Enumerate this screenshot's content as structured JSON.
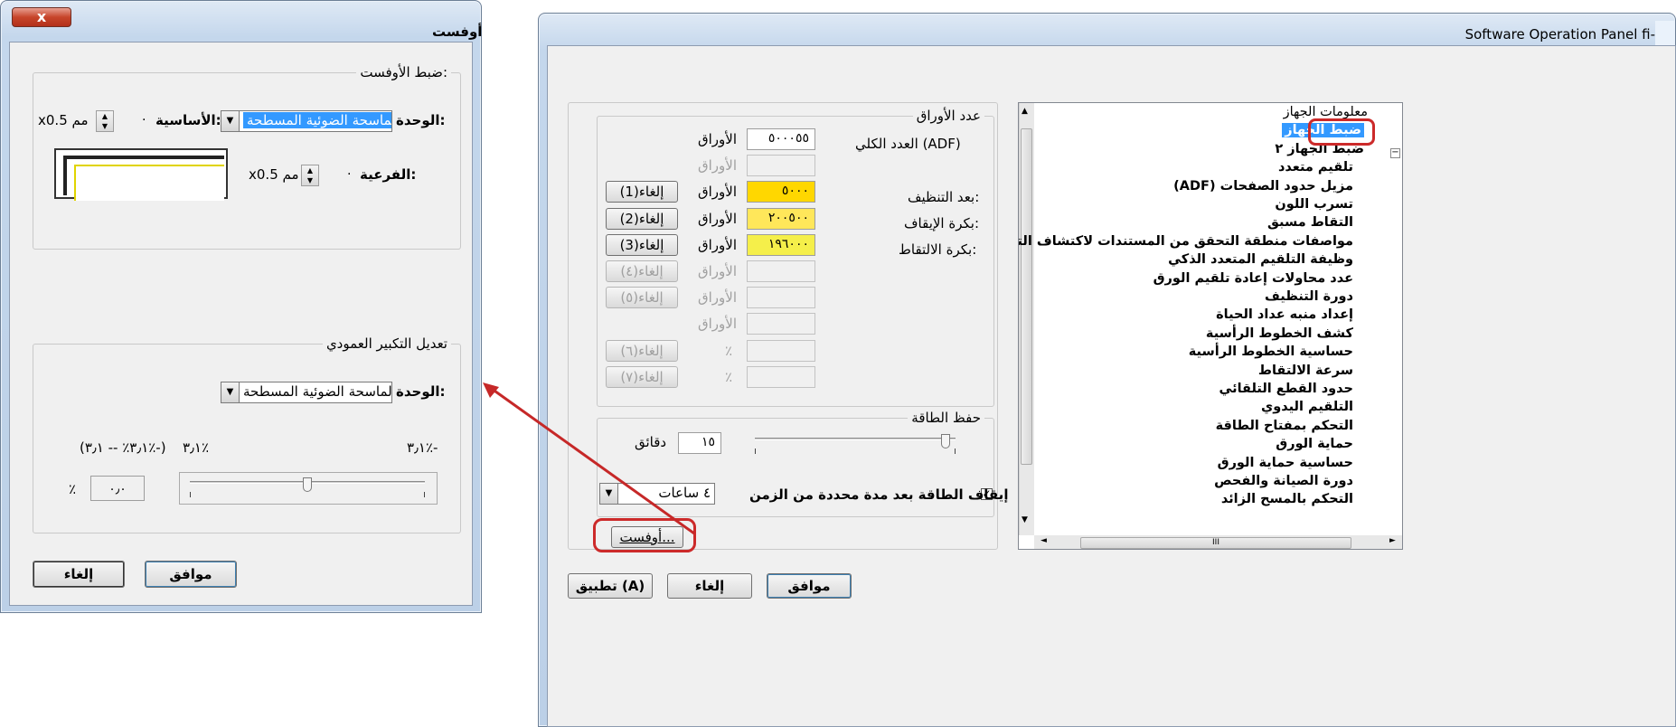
{
  "right_window": {
    "title": "Software Operation Panel fi-",
    "tree": {
      "items": [
        "معلومات الجهاز",
        "ضبط الجهاز",
        "ضبط الجهاز ٢",
        "تلقيم متعدد",
        "مزيل حدود الصفحات (ADF)",
        "تسرب اللون",
        "التقاط مسبق",
        "مواصفات منطقة التحقق من المستندات لاكتشاف التلقيم المتعدد",
        "وظيفة التلقيم المتعدد الذكي",
        "عدد محاولات إعادة تلقيم الورق",
        "دورة التنظيف",
        "إعداد منبه عداد الحياة",
        "كشف الخطوط الرأسية",
        "حساسية الخطوط الرأسية",
        "سرعة الالتقاط",
        "حدود القطع التلقائي",
        "التلقيم اليدوي",
        "التحكم بمفتاح الطاقة",
        "حماية الورق",
        "حساسية حماية الورق",
        "دورة الصيانة والفحص",
        "التحكم بالمسح الزائد"
      ],
      "scroll_marker": "III"
    },
    "sheets_group": {
      "legend": "عدد الأوراق",
      "total_label": "العدد الكلي (ADF)",
      "after_clean_label": "بعد التنظيف:",
      "brake_roller_label": "بكرة الإيقاف:",
      "pick_roller_label": "بكرة الالتقاط:",
      "unit": "الأوراق",
      "percent": "٪",
      "rows": [
        {
          "value": "٥٠٠٠٥٥",
          "button": ""
        },
        {
          "value": "",
          "button": ""
        },
        {
          "value": "٥٠٠٠",
          "button": "إلغاء(1)"
        },
        {
          "value": "٢٠٠٥٠٠",
          "button": "إلغاء(2)"
        },
        {
          "value": "١٩٦٠٠٠",
          "button": "إلغاء(3)"
        },
        {
          "value": "",
          "button": "إلغاء(٤)"
        },
        {
          "value": "",
          "button": "إلغاء(٥)"
        },
        {
          "value": "",
          "button": ""
        },
        {
          "value": "",
          "button": "إلغاء(٦)"
        },
        {
          "value": "",
          "button": "إلغاء(٧)"
        }
      ]
    },
    "power_group": {
      "legend": "حفظ الطاقة",
      "minutes_value": "١٥",
      "minutes_unit": "دقائق",
      "slider_level": 0.95,
      "auto_off_label": "إيقاف الطاقة بعد مدة محددة من الزمن",
      "auto_off_checked": true,
      "hours_value": "٤ ساعات"
    },
    "offset_button": "أوفست...",
    "buttons": {
      "ok": "موافق",
      "cancel": "إلغاء",
      "apply": "تطبيق (A)"
    }
  },
  "left_window": {
    "title": "أوفست",
    "close": "x",
    "offset_group": {
      "legend": "ضبط الأوفست:",
      "unit_label": "الوحدة:",
      "unit_value": "الماسحة الضوئية المسطحة",
      "main_label": "الأساسية:",
      "main_value": "٠",
      "main_suffix": "x0.5 مم",
      "sub_label": "الفرعية:",
      "sub_value": "٠",
      "sub_suffix": "x0.5 مم"
    },
    "vertical_group": {
      "legend": "تعديل التكبير العمودي",
      "unit_label": "الوحدة:",
      "unit_value": "الماسحة الضوئية المسطحة",
      "range_text": "(٣٫١٪ -- ٣٫١٪-)",
      "max_text": "٣٫١٪",
      "min_text": "٣٫١٪-",
      "percent": "٪",
      "value": "٠٫٠",
      "slider_level": 0.5
    },
    "buttons": {
      "ok": "موافق",
      "cancel": "إلغاء"
    }
  },
  "colors": {
    "highlight": "#cc2a2a",
    "yellow1": "#ffd700",
    "yellow2": "#ffe75a",
    "yellow3": "#f5ef4a",
    "selection": "#3399ff"
  }
}
